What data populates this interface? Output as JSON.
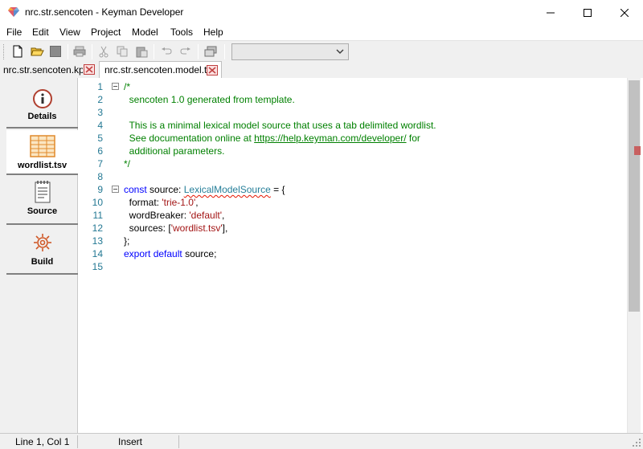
{
  "window": {
    "title": "nrc.str.sencoten - Keyman Developer",
    "app_icon": "keyman-diamond-icon",
    "controls": [
      "minimize-icon",
      "maximize-icon",
      "close-icon"
    ]
  },
  "menu": {
    "items": [
      "File",
      "Edit",
      "View",
      "Project",
      "Model",
      "Tools",
      "Help"
    ]
  },
  "toolbar": {
    "buttons": [
      "new-file-icon",
      "open-folder-icon",
      "save-icon",
      "print-icon",
      "cut-icon",
      "copy-icon",
      "paste-icon",
      "undo-icon",
      "redo-icon",
      "window-icon"
    ],
    "combo_value": ""
  },
  "tabs": [
    {
      "label": "nrc.str.sencoten.kpj",
      "active": false
    },
    {
      "label": "nrc.str.sencoten.model.ts",
      "active": true
    }
  ],
  "side_panel": {
    "items": [
      {
        "label": "Details",
        "icon": "info-icon"
      },
      {
        "label": "wordlist.tsv",
        "icon": "spreadsheet-icon"
      },
      {
        "label": "Source",
        "icon": "notepad-icon"
      },
      {
        "label": "Build",
        "icon": "gear-icon"
      }
    ]
  },
  "editor": {
    "line_numbers": [
      "1",
      "2",
      "3",
      "4",
      "5",
      "6",
      "7",
      "8",
      "9",
      "10",
      "11",
      "12",
      "13",
      "14",
      "15"
    ],
    "lines": {
      "l1": "/*",
      "l2": "  sencoten 1.0 generated from template.",
      "l3": "",
      "l4": "  This is a minimal lexical model source that uses a tab delimited wordlist.",
      "l5a": "  See documentation online at ",
      "l5b": "https://help.keyman.com/developer/",
      "l5c": " for",
      "l6": "  additional parameters.",
      "l7": "*/",
      "l8": "",
      "l9a": "const",
      "l9b": " source: ",
      "l9c": "LexicalModelSource",
      "l9d": " = {",
      "l10a": "  format: ",
      "l10b": "'trie-1.0'",
      "l10c": ",",
      "l11a": "  wordBreaker: ",
      "l11b": "'default'",
      "l11c": ",",
      "l12a": "  sources: [",
      "l12b": "'wordlist.tsv'",
      "l12c": "],",
      "l13": "};",
      "l14a": "export",
      "l14b": " ",
      "l14c": "default",
      "l14d": " source;",
      "l15": ""
    }
  },
  "status": {
    "position": "Line 1, Col 1",
    "mode": "Insert"
  },
  "colors": {
    "comment": "#008000",
    "keyword": "#0000ff",
    "string": "#a31515",
    "line_number": "#237893"
  }
}
